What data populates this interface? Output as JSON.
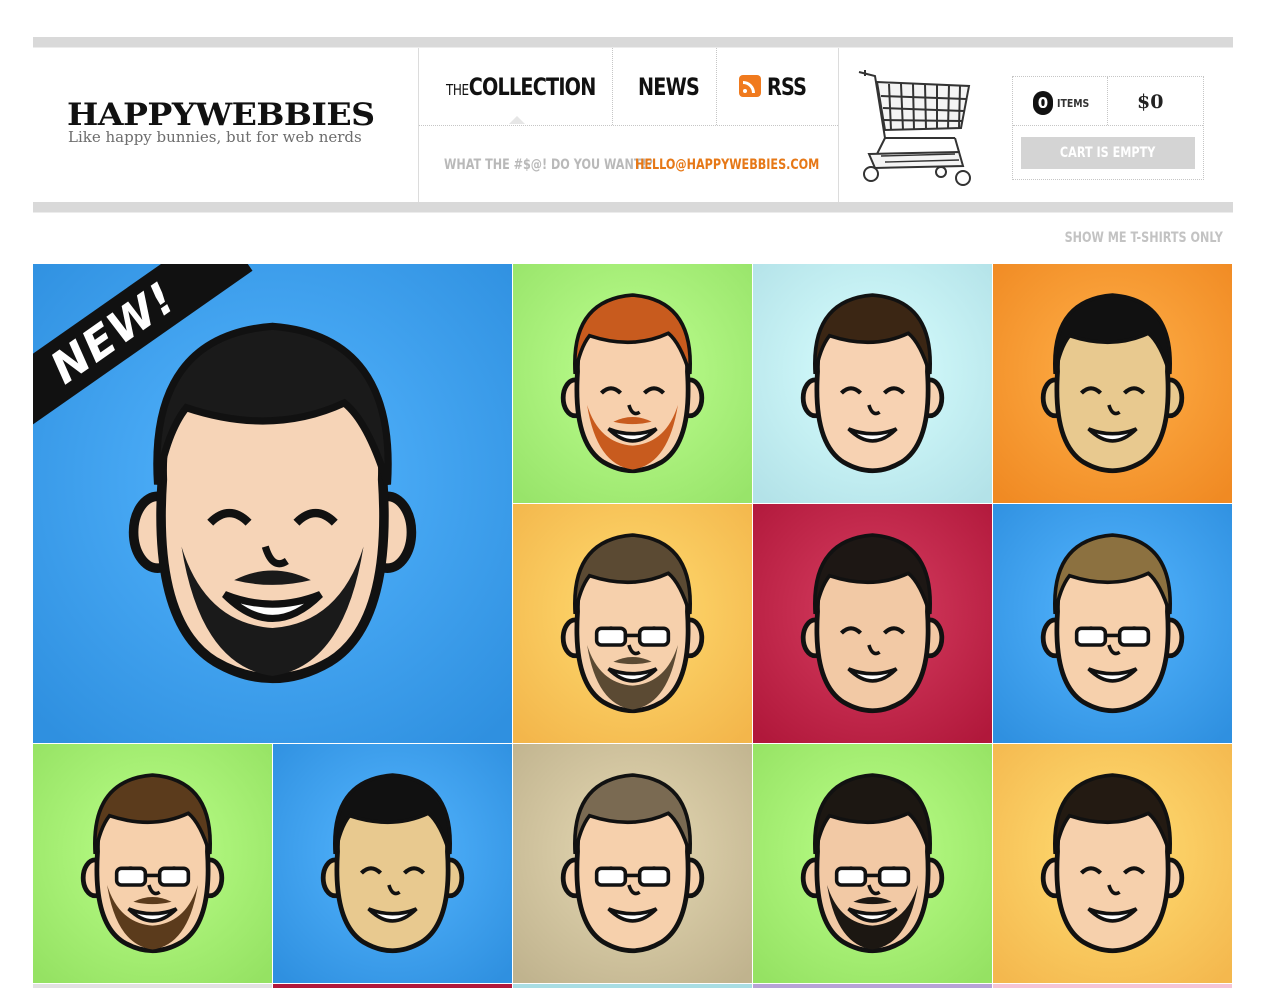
{
  "logo": {
    "name": "HAPPYWEBBIES",
    "tagline": "Like happy bunnies, but for web nerds"
  },
  "nav": {
    "collection_prefix": "THE",
    "collection_label": "COLLECTION",
    "news_label": "NEWS",
    "rss_label": "RSS"
  },
  "contact": {
    "question": "WHAT THE #$@! DO YOU WANT!?",
    "email": "HELLO@HAPPYWEBBIES.COM"
  },
  "cart": {
    "count": "0",
    "items_label": "ITEMS",
    "total": "$0",
    "button_label": "CART IS EMPTY"
  },
  "filter": {
    "tshirts_link": "SHOW ME T-SHIRTS ONLY"
  },
  "featured": {
    "badge": "NEW!"
  },
  "colors": {
    "blue": "#2d8fdf",
    "green": "#8fdf5f",
    "lightblue": "#a8dde3",
    "orange": "#ef8a28",
    "yellow": "#f3b447",
    "red": "#b2163a",
    "tan": "#bfb08a",
    "email_orange": "#e67817"
  },
  "tiles": [
    {
      "name": "avatar-featured-bearded-man",
      "bg": "#2f90e0",
      "hair": "#1a1a1a",
      "skin": "#f6d4b7",
      "glasses": false,
      "beard": true
    },
    {
      "name": "avatar-redhead-man",
      "bg": "#98e46a",
      "hair": "#c85b1e",
      "skin": "#f7d0ad",
      "glasses": false,
      "beard": true
    },
    {
      "name": "avatar-brunette-woman",
      "bg": "#b3e2e8",
      "hair": "#3b2614",
      "skin": "#f7d2b2",
      "glasses": false,
      "beard": false
    },
    {
      "name": "avatar-smiling-man-orange",
      "bg": "#f08a23",
      "hair": "#111111",
      "skin": "#e8c98f",
      "glasses": false,
      "beard": false
    },
    {
      "name": "avatar-glasses-goatee-man",
      "bg": "#f3b64b",
      "hair": "#5b4a33",
      "skin": "#f6d0ac",
      "glasses": true,
      "beard": true
    },
    {
      "name": "avatar-curly-hair-man",
      "bg": "#b1183b",
      "hair": "#1d1714",
      "skin": "#f2c9a5",
      "glasses": false,
      "beard": false
    },
    {
      "name": "avatar-glasses-man-blue",
      "bg": "#2f90e0",
      "hair": "#8c7140",
      "skin": "#f6d0ac",
      "glasses": true,
      "beard": false
    },
    {
      "name": "avatar-glasses-mustache-man",
      "bg": "#95e263",
      "hair": "#5b3b1c",
      "skin": "#f6d0ac",
      "glasses": true,
      "beard": true
    },
    {
      "name": "avatar-asian-man",
      "bg": "#2f90e0",
      "hair": "#111111",
      "skin": "#e8c98f",
      "glasses": false,
      "beard": false
    },
    {
      "name": "avatar-glasses-man-tan",
      "bg": "#c0b38e",
      "hair": "#7a6a52",
      "skin": "#f6d0ac",
      "glasses": true,
      "beard": false
    },
    {
      "name": "avatar-glasses-goatee-man-green",
      "bg": "#95e263",
      "hair": "#1c1712",
      "skin": "#f2c9a5",
      "glasses": true,
      "beard": true
    },
    {
      "name": "avatar-curly-man-yellow",
      "bg": "#f4b84e",
      "hair": "#231a12",
      "skin": "#f6d0ac",
      "glasses": false,
      "beard": false
    }
  ],
  "partial_row_colors": [
    "#e1e1e1",
    "#b1183b",
    "#a8dde3",
    "#b6a3d6",
    "#f4c4d6"
  ]
}
